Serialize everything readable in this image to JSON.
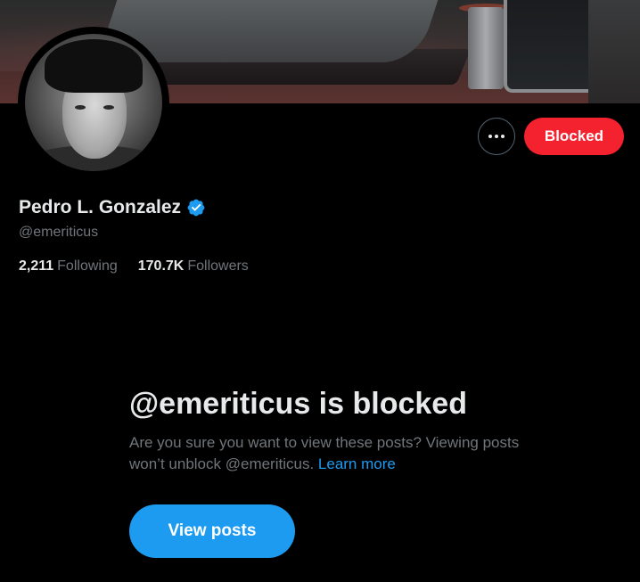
{
  "banner": {
    "alt": "profile-banner-image"
  },
  "profile": {
    "display_name": "Pedro L. Gonzalez",
    "handle": "@emeriticus",
    "verified": true,
    "verified_color": "#1d9bf0"
  },
  "actions": {
    "more_icon": "more-horizontal-icon",
    "blocked_label": "Blocked",
    "blocked_color": "#f4212e"
  },
  "stats": {
    "following_count": "2,211",
    "following_label": "Following",
    "followers_count": "170.7K",
    "followers_label": "Followers"
  },
  "blocked_notice": {
    "title": "@emeriticus is blocked",
    "description": "Are you sure you want to view these posts? Viewing posts won’t unblock @emeriticus.",
    "learn_more": "Learn more",
    "view_posts_label": "View posts",
    "accent_color": "#1d9bf0"
  }
}
